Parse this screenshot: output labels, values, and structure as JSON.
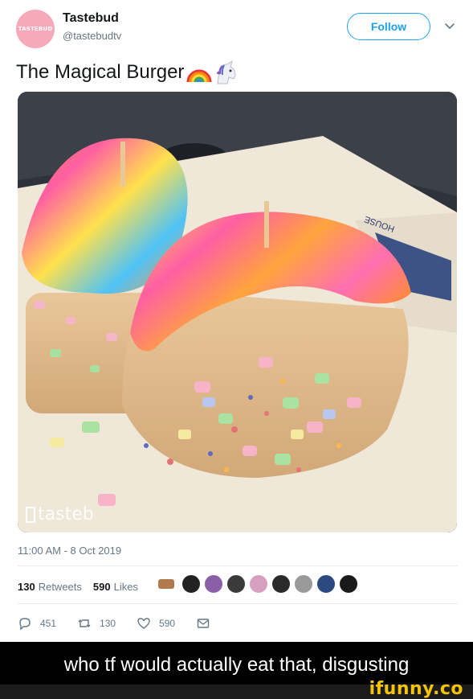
{
  "account": {
    "name": "Tastebud",
    "handle": "@tastebudtv",
    "avatar_text": "TASTEBUD",
    "avatar_color": "#f7a9b9"
  },
  "follow_button": {
    "label": "Follow",
    "color": "#1da1f2"
  },
  "menu_icon": "chevron-down-icon",
  "tweet": {
    "text": "The Magical Burger",
    "emojis": [
      "rainbow-emoji",
      "unicorn-emoji"
    ]
  },
  "media": {
    "watermark": "tasteb",
    "wrapper_text": "HOUSE"
  },
  "meta": {
    "timestamp": "11:00 AM - 8 Oct 2019"
  },
  "stats": {
    "retweets_count": "130",
    "retweets_label": "Retweets",
    "likes_count": "590",
    "likes_label": "Likes"
  },
  "likers": [
    {
      "color": "#b07a4a"
    },
    {
      "color": "#222222"
    },
    {
      "color": "#8a5fa8"
    },
    {
      "color": "#3a3a3a"
    },
    {
      "color": "#d8a0c0"
    },
    {
      "color": "#2a2a2a"
    },
    {
      "color": "#9a9a9a"
    },
    {
      "color": "#2b4a80"
    },
    {
      "color": "#1a1a1a"
    }
  ],
  "actions": {
    "replies": "451",
    "retweets": "130",
    "likes": "590"
  },
  "caption": "who tf would actually eat that, disgusting",
  "brand": "ifunny.co",
  "colors": {
    "accent": "#1da1f2",
    "muted": "#657786",
    "ifunny_yellow": "#f5c400"
  }
}
